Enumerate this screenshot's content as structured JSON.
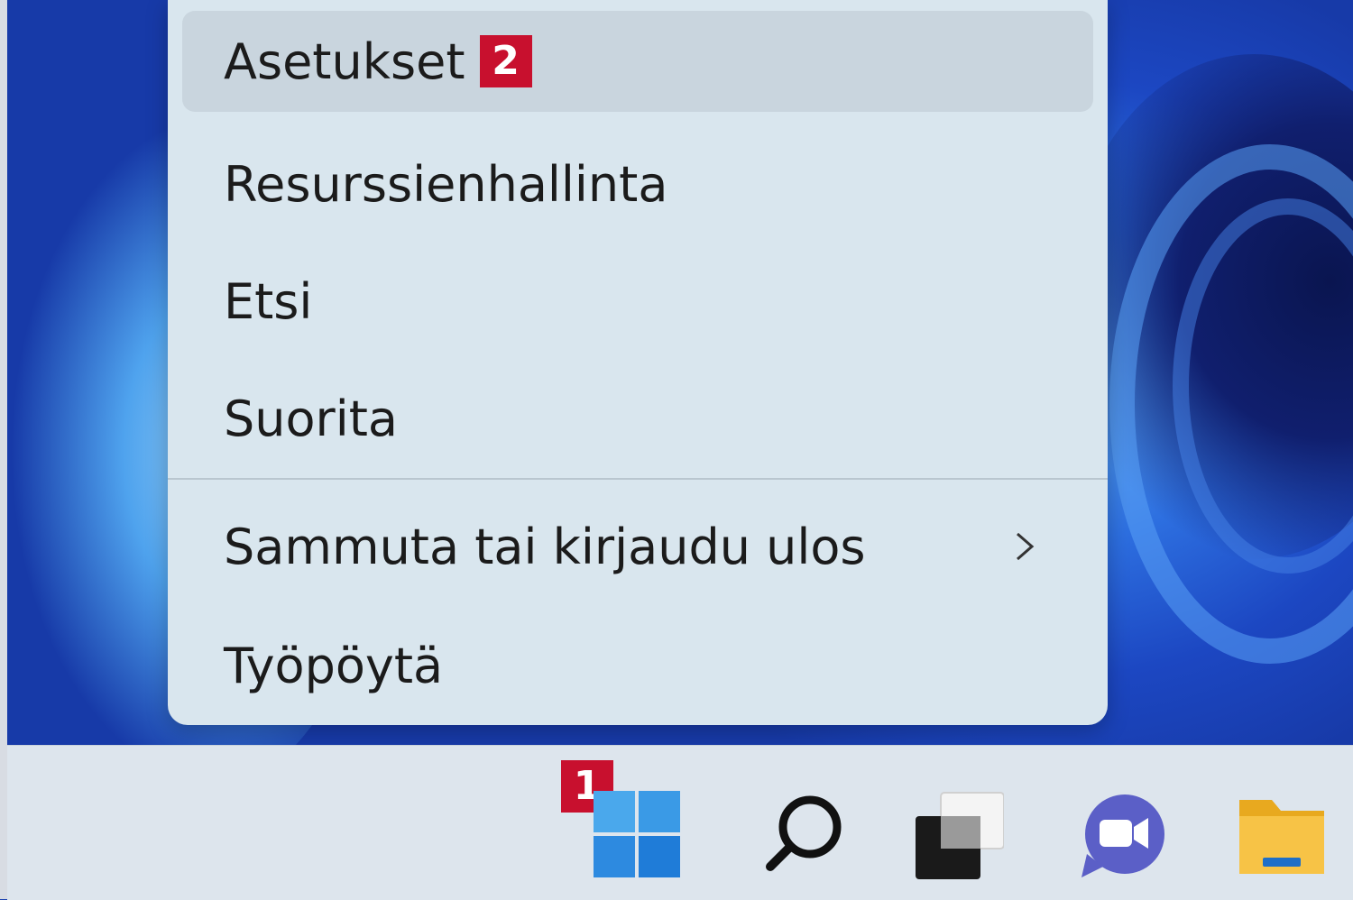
{
  "menu": {
    "items": [
      {
        "label": "Asetukset",
        "badge": "2"
      },
      {
        "label": "Resurssienhallinta"
      },
      {
        "label": "Etsi"
      },
      {
        "label": "Suorita"
      },
      {
        "label": "Sammuta tai kirjaudu ulos"
      },
      {
        "label": "Työpöytä"
      }
    ]
  },
  "taskbar": {
    "start_badge": "1",
    "icons": [
      "windows-start-icon",
      "search-icon",
      "task-view-icon",
      "chat-icon",
      "file-explorer-icon"
    ]
  },
  "colors": {
    "badge": "#c8102e",
    "menu_bg": "#d9e6ee",
    "highlight": "#c9d5de",
    "taskbar": "#dde5ed",
    "windows_blue": "#1f8ee0",
    "chat_purple": "#5b5fc7",
    "folder_yellow": "#f7c346"
  }
}
